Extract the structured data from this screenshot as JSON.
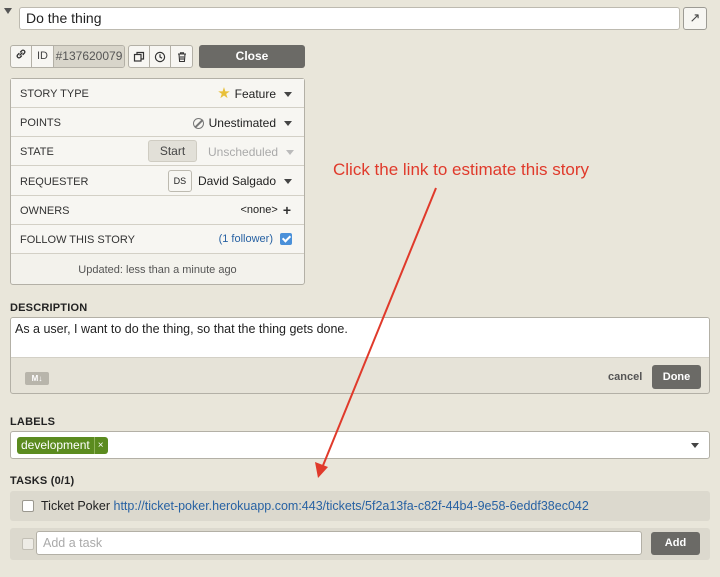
{
  "header": {
    "title_value": "Do the thing",
    "expand_icon": "↗"
  },
  "id_bar": {
    "link_icon": "link-icon",
    "id_label": "ID",
    "id_value": "#137620079",
    "actions": [
      "clone-icon",
      "history-icon",
      "trash-icon"
    ],
    "close_label": "Close"
  },
  "info": {
    "story_type": {
      "label": "STORY TYPE",
      "value": "Feature"
    },
    "points": {
      "label": "POINTS",
      "value": "Unestimated"
    },
    "state": {
      "label": "STATE",
      "start_label": "Start",
      "value": "Unscheduled"
    },
    "requester": {
      "label": "REQUESTER",
      "initials": "DS",
      "value": "David Salgado"
    },
    "owners": {
      "label": "OWNERS",
      "value": "<none>",
      "add_symbol": "+"
    },
    "follow": {
      "label": "FOLLOW THIS STORY",
      "followers": "(1 follower)",
      "checked": true
    },
    "updated": "Updated: less than a minute ago"
  },
  "description": {
    "label": "DESCRIPTION",
    "text": "As a user, I want to do the thing, so that the thing gets done.",
    "markdown_badge": "M↓",
    "cancel_label": "cancel",
    "done_label": "Done"
  },
  "labels": {
    "label": "LABELS",
    "chips": [
      {
        "text": "development",
        "remove": "×"
      }
    ]
  },
  "tasks": {
    "label": "TASKS (0/1)",
    "items": [
      {
        "prefix": "Ticket Poker",
        "url": "http://ticket-poker.herokuapp.com:443/tickets/5f2a13fa-c82f-44b4-9e58-6eddf38ec042",
        "done": false
      }
    ],
    "new_placeholder": "Add a task",
    "add_label": "Add"
  },
  "annotation": {
    "text": "Click the link to estimate this story",
    "color": "#e03a2b"
  },
  "colors": {
    "background": "#e9e6da",
    "button_dark": "#6b6a66",
    "link": "#2862a3",
    "label_green": "#5b8b1f",
    "checkbox_blue": "#4a90d9",
    "star": "#e8c03a"
  }
}
